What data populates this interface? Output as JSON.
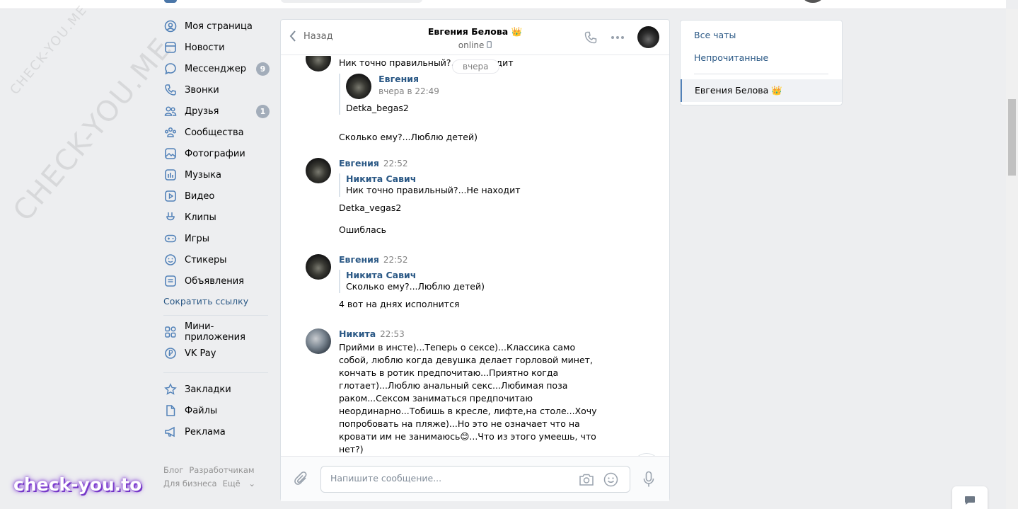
{
  "left_nav": {
    "items": [
      {
        "label": "Моя страница",
        "icon": "user-circle-icon"
      },
      {
        "label": "Новости",
        "icon": "news-icon"
      },
      {
        "label": "Мессенджер",
        "icon": "messenger-icon",
        "count": "9"
      },
      {
        "label": "Звонки",
        "icon": "phone-icon"
      },
      {
        "label": "Друзья",
        "icon": "friends-icon",
        "count": "1"
      },
      {
        "label": "Сообщества",
        "icon": "communities-icon"
      },
      {
        "label": "Фотографии",
        "icon": "photo-icon"
      },
      {
        "label": "Музыка",
        "icon": "music-icon"
      },
      {
        "label": "Видео",
        "icon": "video-icon"
      },
      {
        "label": "Клипы",
        "icon": "clips-icon"
      },
      {
        "label": "Игры",
        "icon": "games-icon"
      },
      {
        "label": "Стикеры",
        "icon": "stickers-icon"
      },
      {
        "label": "Объявления",
        "icon": "ads-icon"
      }
    ],
    "shorten_link": "Сократить ссылку",
    "group2": [
      {
        "label": "Мини-приложения",
        "icon": "mini-apps-icon"
      },
      {
        "label": "VK Pay",
        "icon": "vkpay-icon"
      }
    ],
    "group3": [
      {
        "label": "Закладки",
        "icon": "bookmark-icon"
      },
      {
        "label": "Файлы",
        "icon": "file-icon"
      },
      {
        "label": "Реклама",
        "icon": "megaphone-icon"
      }
    ],
    "footer": {
      "blog": "Блог",
      "devs": "Разработчикам",
      "business": "Для бизнеса",
      "more": "Ещё"
    }
  },
  "chat": {
    "back_label": "Назад",
    "peer_name": "Евгения Белова 👑",
    "peer_status": "online",
    "day_label": "вчера",
    "messages": {
      "m0_text": "Ник точно правильный?...Не находит",
      "m0_fwd_author": "Евгения",
      "m0_fwd_time": "вчера в 22:49",
      "m0_fwd_text": "Detka_begas2",
      "m0_text2": "Сколько ему?...Люблю детей)",
      "m1_author": "Евгения",
      "m1_time": "22:52",
      "m1_fwd_author": "Никита Савич",
      "m1_fwd_text": "Ник точно правильный?...Не находит",
      "m1_text": "Detka_vegas2",
      "m1_text2": "Ошиблась",
      "m2_author": "Евгения",
      "m2_time": "22:52",
      "m2_fwd_author": "Никита Савич",
      "m2_fwd_text": "Сколько ему?...Люблю детей)",
      "m2_text": "4 вот на днях исполнится",
      "m3_author": "Никита",
      "m3_time": "22:53",
      "m3_text": "Прийми в инсте)...Теперь о сексе)...Классика само собой, люблю когда девушка делает горловой минет, кончать в ротик предпочитаю...Приятно когда глотает)...Люблю анальный секс...Любимая поза раком...Сексом заниматься предпочитаю неординарно...Тобишь в кресле, лифте,на столе...Хочу попробовать на пляже)...Но это не означает что на кровати им не занимаюсь😊...Что из этого умеешь, что нет?)"
    },
    "composer_placeholder": "Напишите сообщение..."
  },
  "right_panel": {
    "all_chats": "Все чаты",
    "unread": "Непрочитанные",
    "active_chat": "Евгения Белова 👑"
  },
  "watermark": {
    "diagonal": "CHECK-YOU.ME",
    "bottom": "check-you.to"
  },
  "colors": {
    "link": "#2a5885",
    "accent": "#5181b8",
    "badge": "#a3adba",
    "background": "#edeef0"
  }
}
